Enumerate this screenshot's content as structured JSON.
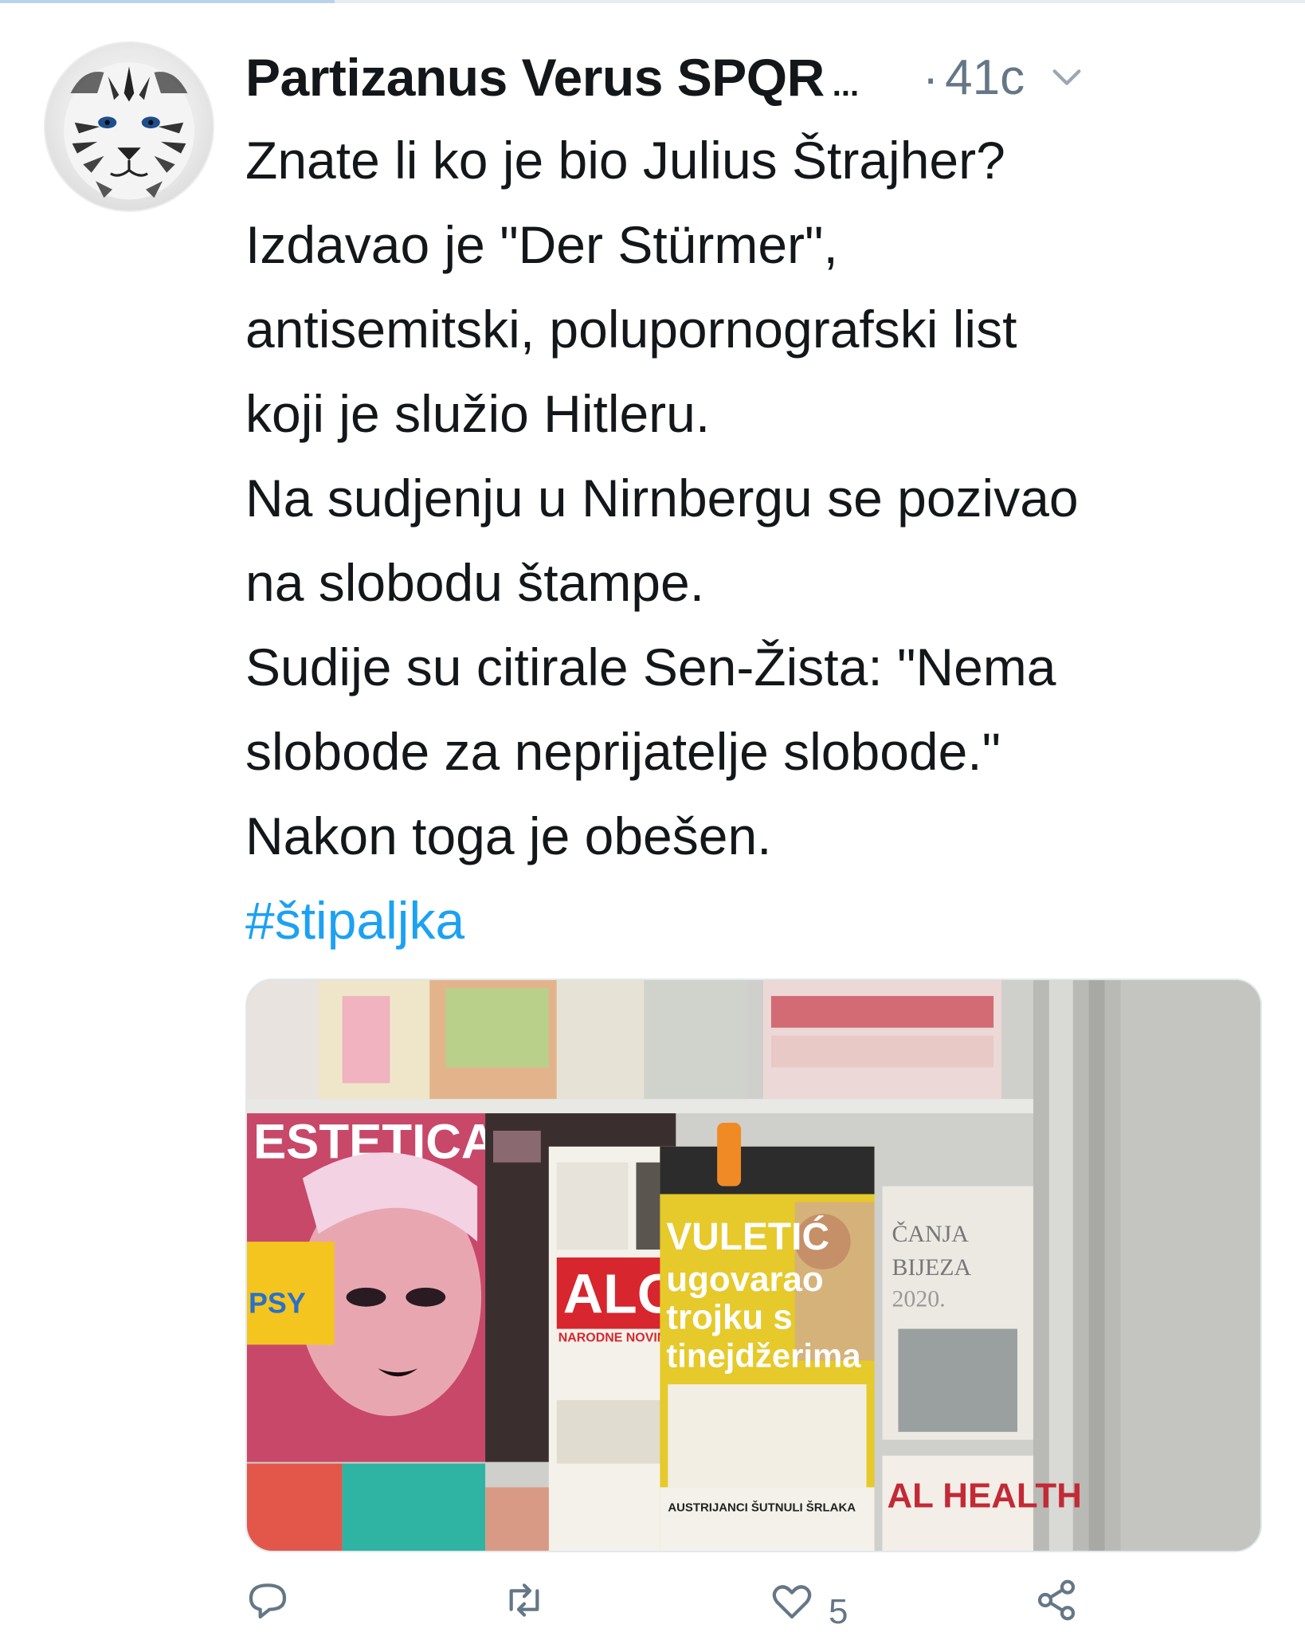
{
  "tweet": {
    "author": {
      "display_name": "Partizanus Verus SPQR",
      "name_truncation": "...",
      "avatar_icon": "white-tiger-avatar"
    },
    "separator": "·",
    "timestamp": "41c",
    "menu_icon": "chevron-down-icon",
    "text_lines": [
      "Znate li ko je bio Julius Štrajher?",
      "Izdavao je \"Der Stürmer\",",
      "antisemitski, polupornografski list",
      "koji je služio Hitleru.",
      "Na sudjenju u Nirnbergu se pozivao",
      "na slobodu štampe.",
      "Sudije su citirale Sen-Žista: \"Nema",
      "slobode za neprijatelje slobode.\"",
      "Nakon toga je obešen."
    ],
    "hashtag": "#štipaljka",
    "hashtag_color": "#1da1f2",
    "media": {
      "description_icon": "newsstand-photo",
      "visible_text": {
        "magazine_left": "ESTETICA",
        "tag_left": "PSY",
        "paper_center_mast": "ALO!",
        "paper_center_sub": "NARODNE NOVINE",
        "headline_1": "VULETIĆ",
        "headline_2": "ugovarao",
        "headline_3": "trojku s",
        "headline_4": "tinejdžerima",
        "footer_headline": "AUSTRIJANCI ŠUTNULI ŠRLAKA",
        "right_magazine": "AL HEALTH",
        "right_calendar_1": "ČANJA",
        "right_calendar_2": "BIJEZA",
        "right_calendar_year": "2020."
      }
    },
    "actions": {
      "reply": {
        "icon": "reply-icon",
        "count": ""
      },
      "retweet": {
        "icon": "retweet-icon",
        "count": ""
      },
      "like": {
        "icon": "heart-icon",
        "count": "5"
      },
      "share": {
        "icon": "share-icon",
        "count": ""
      }
    },
    "colors": {
      "text": "#14171a",
      "secondary": "#657786",
      "accent": "#1da1f2"
    }
  }
}
